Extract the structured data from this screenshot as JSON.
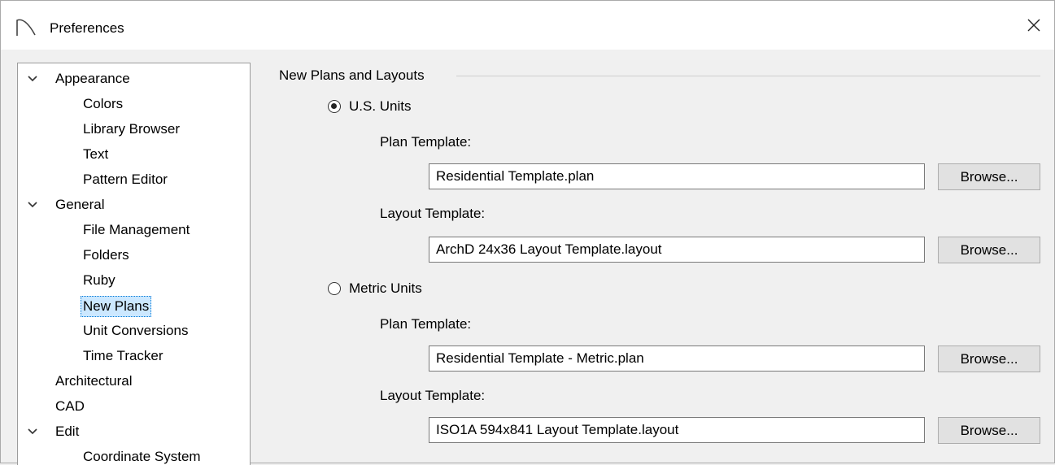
{
  "window": {
    "title": "Preferences"
  },
  "tree": {
    "items": [
      {
        "label": "Appearance",
        "level": 0,
        "expanded": true
      },
      {
        "label": "Colors",
        "level": 1
      },
      {
        "label": "Library Browser",
        "level": 1
      },
      {
        "label": "Text",
        "level": 1
      },
      {
        "label": "Pattern Editor",
        "level": 1
      },
      {
        "label": "General",
        "level": 0,
        "expanded": true
      },
      {
        "label": "File Management",
        "level": 1
      },
      {
        "label": "Folders",
        "level": 1
      },
      {
        "label": "Ruby",
        "level": 1
      },
      {
        "label": "New Plans",
        "level": 1,
        "selected": true
      },
      {
        "label": "Unit Conversions",
        "level": 1
      },
      {
        "label": "Time Tracker",
        "level": 1
      },
      {
        "label": "Architectural",
        "level": 0
      },
      {
        "label": "CAD",
        "level": 0
      },
      {
        "label": "Edit",
        "level": 0,
        "expanded": true
      },
      {
        "label": "Coordinate System",
        "level": 1
      }
    ]
  },
  "panel": {
    "group_title": "New Plans and Layouts",
    "us": {
      "label": "U.S. Units",
      "selected": true,
      "plan_label": "Plan Template:",
      "plan_value": "Residential Template.plan",
      "layout_label": "Layout Template:",
      "layout_value": "ArchD 24x36 Layout Template.layout"
    },
    "metric": {
      "label": "Metric Units",
      "selected": false,
      "plan_label": "Plan Template:",
      "plan_value": "Residential Template - Metric.plan",
      "layout_label": "Layout Template:",
      "layout_value": "ISO1A 594x841 Layout Template.layout"
    },
    "browse_label": "Browse..."
  }
}
